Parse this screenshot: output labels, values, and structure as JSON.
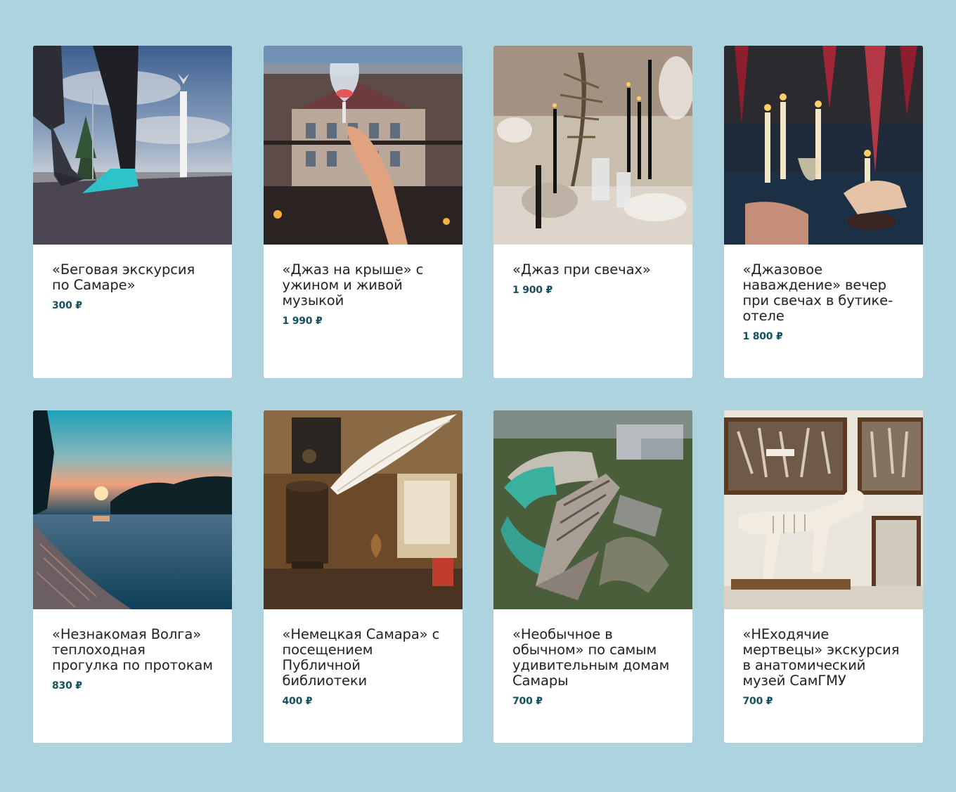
{
  "colors": {
    "background": "#add4de",
    "card": "#ffffff",
    "title_text": "#222222",
    "price_text": "#14505f"
  },
  "cards": [
    {
      "title": "«Беговая экскурсия по Самаре»",
      "price": "300 ₽",
      "image": "running-tour-photo"
    },
    {
      "title": "«Джаз на крыше» с ужином и живой музыкой",
      "price": "1 990 ₽",
      "image": "jazz-rooftop-photo"
    },
    {
      "title": "«Джаз при свечах»",
      "price": "1 900 ₽",
      "image": "candle-jazz-photo"
    },
    {
      "title": "«Джазовое наваждение» вечер при свечах в бутике-отеле",
      "price": "1 800 ₽",
      "image": "jazz-obsession-photo"
    },
    {
      "title": "«Незнакомая Волга» теплоходная прогулка по протокам",
      "price": "830 ₽",
      "image": "volga-sunset-photo"
    },
    {
      "title": "«Немецкая Самара» с посещением Публичной библиотеки",
      "price": "400 ₽",
      "image": "quill-inkwell-photo"
    },
    {
      "title": "«Необычное в обычном» по самым удивительным домам Самары",
      "price": "700 ₽",
      "image": "aerial-building-photo"
    },
    {
      "title": "«НЕходячие мертвецы» экскурсия в анатомический музей СамГМУ",
      "price": "700 ₽",
      "image": "anatomy-museum-photo"
    }
  ]
}
